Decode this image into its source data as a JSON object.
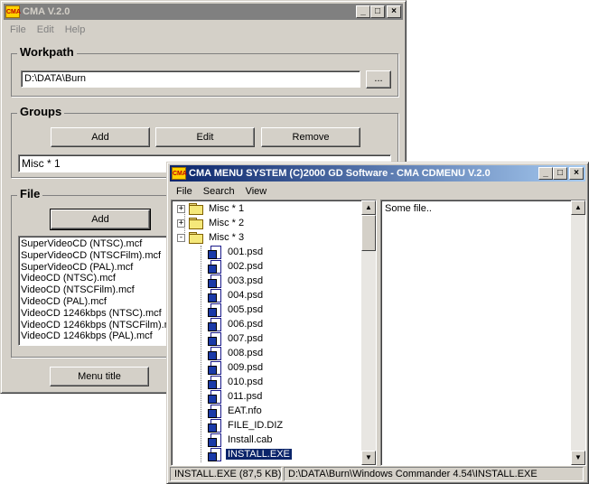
{
  "main_window": {
    "icon_text": "CMA",
    "title": "CMA V.2.0",
    "menu": [
      "File",
      "Edit",
      "Help"
    ],
    "workpath": {
      "label": "Workpath",
      "value": "D:\\DATA\\Burn",
      "browse_label": "..."
    },
    "groups": {
      "label": "Groups",
      "add_label": "Add",
      "edit_label": "Edit",
      "remove_label": "Remove",
      "selected_group": "Misc * 1"
    },
    "file": {
      "label": "File",
      "add_label": "Add",
      "items": [
        "SuperVideoCD (NTSC).mcf",
        "SuperVideoCD (NTSCFilm).mcf",
        "SuperVideoCD (PAL).mcf",
        "VideoCD (NTSC).mcf",
        "VideoCD (NTSCFilm).mcf",
        "VideoCD (PAL).mcf",
        "VideoCD 1246kbps (NTSC).mcf",
        "VideoCD 1246kbps (NTSCFilm).m",
        "VideoCD 1246kbps (PAL).mcf"
      ]
    },
    "menu_title_label": "Menu title"
  },
  "cdmenu_window": {
    "icon_text": "CMA",
    "title": "CMA MENU SYSTEM (C)2000 GD Software - CMA CDMENU V.2.0",
    "menu": [
      "File",
      "Search",
      "View"
    ],
    "tree": {
      "groups": [
        {
          "label": "Misc * 1",
          "expander": "+"
        },
        {
          "label": "Misc * 2",
          "expander": "+"
        },
        {
          "label": "Misc * 3",
          "expander": "-"
        }
      ],
      "files": [
        "001.psd",
        "002.psd",
        "003.psd",
        "004.psd",
        "005.psd",
        "006.psd",
        "007.psd",
        "008.psd",
        "009.psd",
        "010.psd",
        "011.psd",
        "EAT.nfo",
        "FILE_ID.DIZ",
        "Install.cab",
        "INSTALL.EXE"
      ],
      "selected_file": "INSTALL.EXE"
    },
    "preview_text": "Some file..",
    "status": {
      "file_info": "INSTALL.EXE (87,5 KB)",
      "path": "D:\\DATA\\Burn\\Windows Commander 4.54\\INSTALL.EXE"
    }
  },
  "window_buttons": {
    "minimize": "_",
    "maximize": "□",
    "close": "×"
  },
  "colors": {
    "face": "#d4d0c8",
    "active_title_start": "#0a246a",
    "active_title_end": "#a6caf0",
    "inactive_title": "#808080",
    "selection": "#0a246a"
  }
}
